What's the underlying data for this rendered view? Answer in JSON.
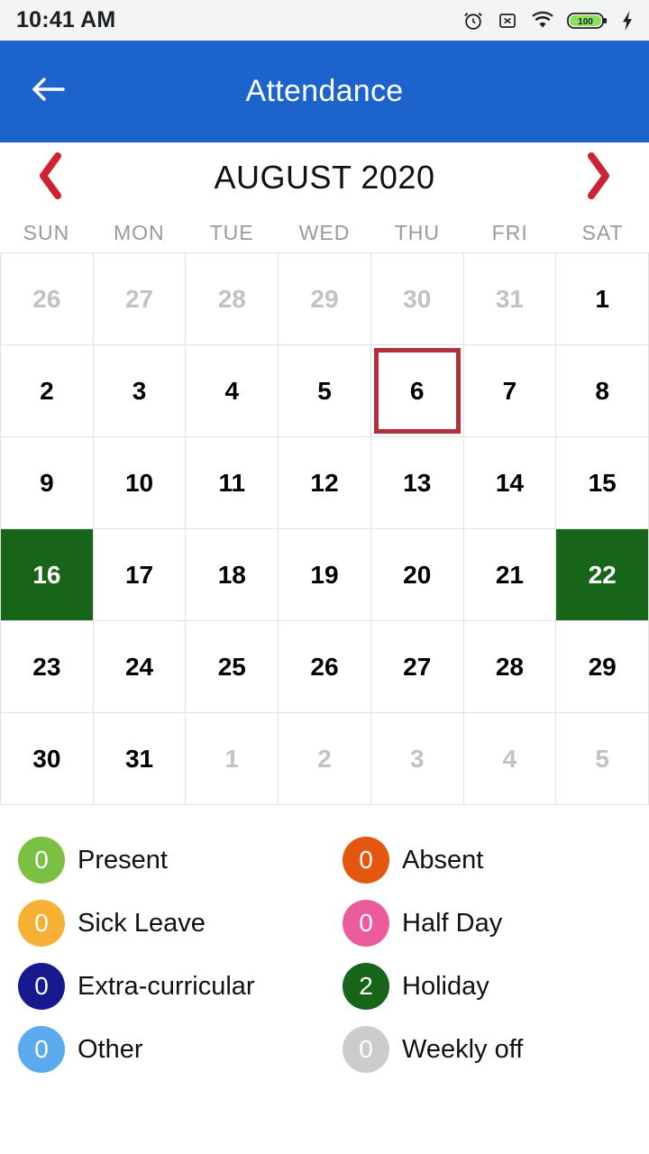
{
  "status_bar": {
    "time": "10:41 AM",
    "battery_level": "100",
    "icons": [
      "alarm-icon",
      "no-sim-icon",
      "wifi-icon",
      "battery-icon",
      "charging-bolt-icon"
    ]
  },
  "app_bar": {
    "title": "Attendance",
    "back_label": "Back"
  },
  "calendar": {
    "month_label": "AUGUST 2020",
    "prev_label": "‹",
    "next_label": "›",
    "weekdays": [
      "SUN",
      "MON",
      "TUE",
      "WED",
      "THU",
      "FRI",
      "SAT"
    ],
    "selected_day": "6",
    "holiday_days": [
      "16",
      "22"
    ],
    "cells": [
      {
        "d": "26",
        "state": "muted"
      },
      {
        "d": "27",
        "state": "muted"
      },
      {
        "d": "28",
        "state": "muted"
      },
      {
        "d": "29",
        "state": "muted"
      },
      {
        "d": "30",
        "state": "muted"
      },
      {
        "d": "31",
        "state": "muted"
      },
      {
        "d": "1",
        "state": "normal"
      },
      {
        "d": "2",
        "state": "normal"
      },
      {
        "d": "3",
        "state": "normal"
      },
      {
        "d": "4",
        "state": "normal"
      },
      {
        "d": "5",
        "state": "normal"
      },
      {
        "d": "6",
        "state": "selected"
      },
      {
        "d": "7",
        "state": "normal"
      },
      {
        "d": "8",
        "state": "normal"
      },
      {
        "d": "9",
        "state": "normal"
      },
      {
        "d": "10",
        "state": "normal"
      },
      {
        "d": "11",
        "state": "normal"
      },
      {
        "d": "12",
        "state": "normal"
      },
      {
        "d": "13",
        "state": "normal"
      },
      {
        "d": "14",
        "state": "normal"
      },
      {
        "d": "15",
        "state": "normal"
      },
      {
        "d": "16",
        "state": "holiday"
      },
      {
        "d": "17",
        "state": "normal"
      },
      {
        "d": "18",
        "state": "normal"
      },
      {
        "d": "19",
        "state": "normal"
      },
      {
        "d": "20",
        "state": "normal"
      },
      {
        "d": "21",
        "state": "normal"
      },
      {
        "d": "22",
        "state": "holiday"
      },
      {
        "d": "23",
        "state": "normal"
      },
      {
        "d": "24",
        "state": "normal"
      },
      {
        "d": "25",
        "state": "normal"
      },
      {
        "d": "26",
        "state": "normal"
      },
      {
        "d": "27",
        "state": "normal"
      },
      {
        "d": "28",
        "state": "normal"
      },
      {
        "d": "29",
        "state": "normal"
      },
      {
        "d": "30",
        "state": "normal"
      },
      {
        "d": "31",
        "state": "normal"
      },
      {
        "d": "1",
        "state": "muted"
      },
      {
        "d": "2",
        "state": "muted"
      },
      {
        "d": "3",
        "state": "muted"
      },
      {
        "d": "4",
        "state": "muted"
      },
      {
        "d": "5",
        "state": "muted"
      }
    ]
  },
  "legend": [
    {
      "count": "0",
      "label": "Present",
      "color": "#7ac143"
    },
    {
      "count": "0",
      "label": "Absent",
      "color": "#e4570f"
    },
    {
      "count": "0",
      "label": "Sick Leave",
      "color": "#f6b134"
    },
    {
      "count": "0",
      "label": "Half Day",
      "color": "#ec5c9b"
    },
    {
      "count": "0",
      "label": "Extra-curricular",
      "color": "#171a8e"
    },
    {
      "count": "2",
      "label": "Holiday",
      "color": "#176518"
    },
    {
      "count": "0",
      "label": "Other",
      "color": "#5caaee"
    },
    {
      "count": "0",
      "label": "Weekly off",
      "color": "#cccccc"
    }
  ],
  "colors": {
    "app_bar_blue": "#1c63cb",
    "chevron_red": "#cc2233",
    "selected_border_red": "#b2303c",
    "holiday_green": "#176518",
    "grid_line": "#e2e2e2",
    "status_bar_bg": "#f2f4f6"
  }
}
